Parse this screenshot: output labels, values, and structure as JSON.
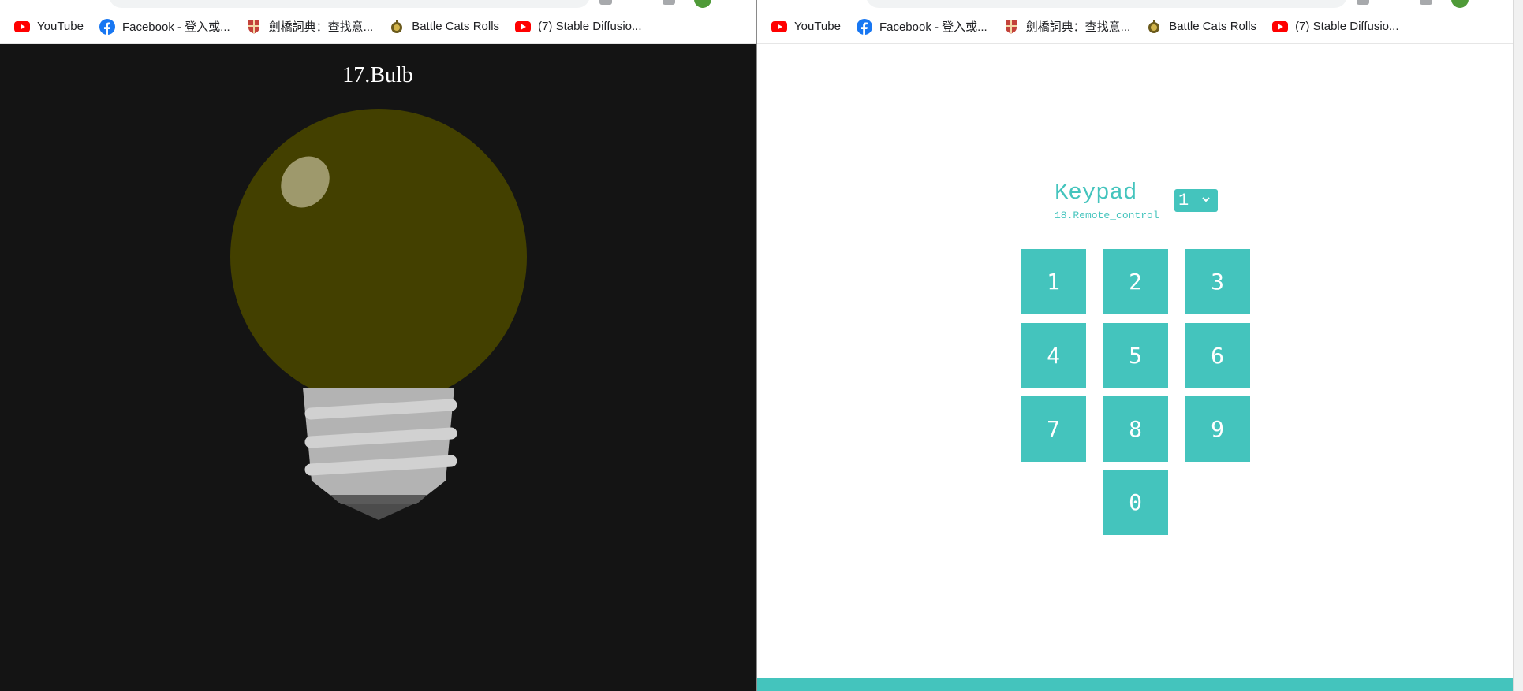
{
  "bookmarks": [
    {
      "label": "YouTube",
      "icon": "youtube-icon"
    },
    {
      "label": "Facebook - 登入或...",
      "icon": "facebook-icon"
    },
    {
      "label": "劍橋詞典：查找意...",
      "icon": "cambridge-icon"
    },
    {
      "label": "Battle Cats Rolls",
      "icon": "battle-cats-icon"
    },
    {
      "label": "(7) Stable Diffusio...",
      "icon": "youtube-icon"
    }
  ],
  "left_page": {
    "title": "17.Bulb",
    "bulb_state": "off"
  },
  "right_page": {
    "title": "Keypad",
    "subtitle": "18.Remote_control",
    "select_value": "1",
    "keys": [
      "1",
      "2",
      "3",
      "4",
      "5",
      "6",
      "7",
      "8",
      "9",
      "0"
    ]
  },
  "colors": {
    "accent": "#44c4bd",
    "left_background": "#141414",
    "bulb_glass": "#434000",
    "bulb_base": "#b3b3b3",
    "youtube_red": "#ff0000",
    "facebook_blue": "#1877f2"
  }
}
